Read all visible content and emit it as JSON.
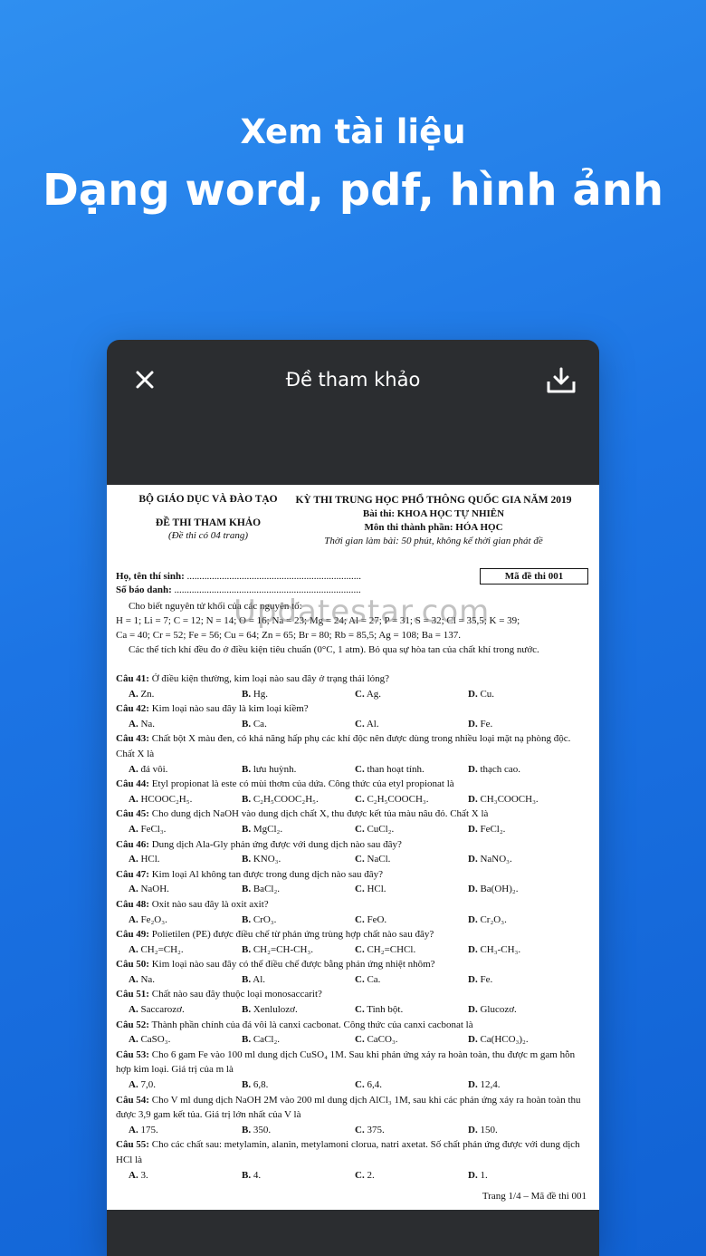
{
  "promo": {
    "line1": "Xem tài liệu",
    "line2": "Dạng word, pdf, hình ảnh"
  },
  "appbar": {
    "close_icon": "close-icon",
    "title": "Đề tham khảo",
    "download_icon": "download-icon"
  },
  "document": {
    "header_left": {
      "ministry": "BỘ GIÁO DỤC VÀ ĐÀO TẠO",
      "exam_type": "ĐỀ THI THAM KHẢO",
      "pages_note": "(Đề thi có 04 trang)"
    },
    "header_right": {
      "exam_name": "KỲ THI TRUNG HỌC PHỔ THÔNG QUỐC GIA NĂM 2019",
      "test": "Bài thi: KHOA HỌC TỰ NHIÊN",
      "subject": "Môn thi thành phần: HÓA HỌC",
      "time": "Thời gian làm bài: 50 phút, không kể thời gian phát đề"
    },
    "candidate_name_label": "Họ, tên thí sinh:",
    "candidate_name_dots": " ......................................................................",
    "candidate_id_label": "Số báo danh:",
    "candidate_id_dots": " ...........................................................................",
    "exam_code": "Mã đề thi 001",
    "atoms_intro": "Cho biết nguyên tử khối của các nguyên tố:",
    "atoms_line1": "H = 1; Li = 7; C = 12; N = 14; O = 16; Na = 23; Mg = 24; Al = 27; P = 31; S = 32; Cl = 35,5; K = 39;",
    "atoms_line2": "Ca = 40; Cr = 52; Fe = 56; Cu = 64; Zn = 65; Br = 80; Rb = 85,5; Ag = 108; Ba = 137.",
    "atoms_note": "Các thể tích khí đều đo ở điều kiện tiêu chuẩn (0°C, 1 atm). Bỏ qua sự hòa tan của chất khí trong nước.",
    "questions": [
      {
        "num": "Câu 41:",
        "text": " Ở điều kiện thường, kim loại nào sau đây ở trạng thái lỏng?",
        "opts": [
          "Zn.",
          "Hg.",
          "Ag.",
          "Cu."
        ]
      },
      {
        "num": "Câu 42:",
        "text": " Kim loại nào sau đây là kim loại kiềm?",
        "opts": [
          "Na.",
          "Ca.",
          "Al.",
          "Fe."
        ]
      },
      {
        "num": "Câu 43:",
        "text": " Chất bột X màu đen, có khả năng hấp phụ các khí độc nên được dùng trong nhiều loại mặt nạ phòng độc. Chất X là",
        "opts": [
          "đá vôi.",
          "lưu huỳnh.",
          "than hoạt tính.",
          "thạch cao."
        ]
      },
      {
        "num": "Câu 44:",
        "text": " Etyl propionat là este có mùi thơm của dứa. Công thức của etyl propionat là",
        "opts": [
          "HCOOC₂H₅.",
          "C₂H₅COOC₂H₅.",
          "C₂H₅COOCH₃.",
          "CH₃COOCH₃."
        ]
      },
      {
        "num": "Câu 45:",
        "text": " Cho dung dịch NaOH vào dung dịch chất X, thu được kết tủa màu nâu đỏ. Chất X là",
        "opts": [
          "FeCl₃.",
          "MgCl₂.",
          "CuCl₂.",
          "FeCl₂."
        ]
      },
      {
        "num": "Câu 46:",
        "text": " Dung dịch Ala-Gly phản ứng được với dung dịch nào sau đây?",
        "opts": [
          "HCl.",
          "KNO₃.",
          "NaCl.",
          "NaNO₃."
        ]
      },
      {
        "num": "Câu 47:",
        "text": " Kim loại Al không tan được trong dung dịch nào sau đây?",
        "opts": [
          "NaOH.",
          "BaCl₂.",
          "HCl.",
          "Ba(OH)₂."
        ]
      },
      {
        "num": "Câu 48:",
        "text": " Oxit nào sau đây là oxit axit?",
        "opts": [
          "Fe₂O₃.",
          "CrO₃.",
          "FeO.",
          "Cr₂O₃."
        ]
      },
      {
        "num": "Câu 49:",
        "text": " Polietilen (PE) được điều chế từ phản ứng trùng hợp chất nào sau đây?",
        "opts": [
          "CH₂=CH₂.",
          "CH₂=CH-CH₃.",
          "CH₂=CHCl.",
          "CH₃-CH₃."
        ]
      },
      {
        "num": "Câu 50:",
        "text": " Kim loại nào sau đây có thể điều chế được bằng phản ứng nhiệt nhôm?",
        "opts": [
          "Na.",
          "Al.",
          "Ca.",
          "Fe."
        ]
      },
      {
        "num": "Câu 51:",
        "text": " Chất nào sau đây thuộc loại monosaccarit?",
        "opts": [
          "Saccarozơ.",
          "Xenlulozơ.",
          "Tinh bột.",
          "Glucozơ."
        ]
      },
      {
        "num": "Câu 52:",
        "text": " Thành phần chính của đá vôi là canxi cacbonat. Công thức của canxi cacbonat là",
        "opts": [
          "CaSO₃.",
          "CaCl₂.",
          "CaCO₃.",
          "Ca(HCO₃)₂."
        ]
      },
      {
        "num": "Câu 53:",
        "text": " Cho 6 gam Fe vào 100 ml dung dịch CuSO₄ 1M. Sau khi phản ứng xảy ra hoàn toàn, thu được m gam hỗn hợp kim loại. Giá trị của m là",
        "opts": [
          "7,0.",
          "6,8.",
          "6,4.",
          "12,4."
        ]
      },
      {
        "num": "Câu 54:",
        "text": " Cho V ml dung dịch NaOH 2M vào 200 ml dung dịch AlCl₃ 1M, sau khi các phản ứng xảy ra hoàn toàn thu được 3,9 gam kết tủa. Giá trị lớn nhất của V là",
        "opts": [
          "175.",
          "350.",
          "375.",
          "150."
        ]
      },
      {
        "num": "Câu 55:",
        "text": " Cho các chất sau: metylamin, alanin, metylamoni clorua, natri axetat. Số chất phản ứng được với dung dịch HCl là",
        "opts": [
          "3.",
          "4.",
          "2.",
          "1."
        ]
      }
    ],
    "option_letters": [
      "A.",
      "B.",
      "C.",
      "D."
    ],
    "footer": "Trang 1/4 – Mã đề thi 001",
    "watermark": "Updatestar.com"
  }
}
